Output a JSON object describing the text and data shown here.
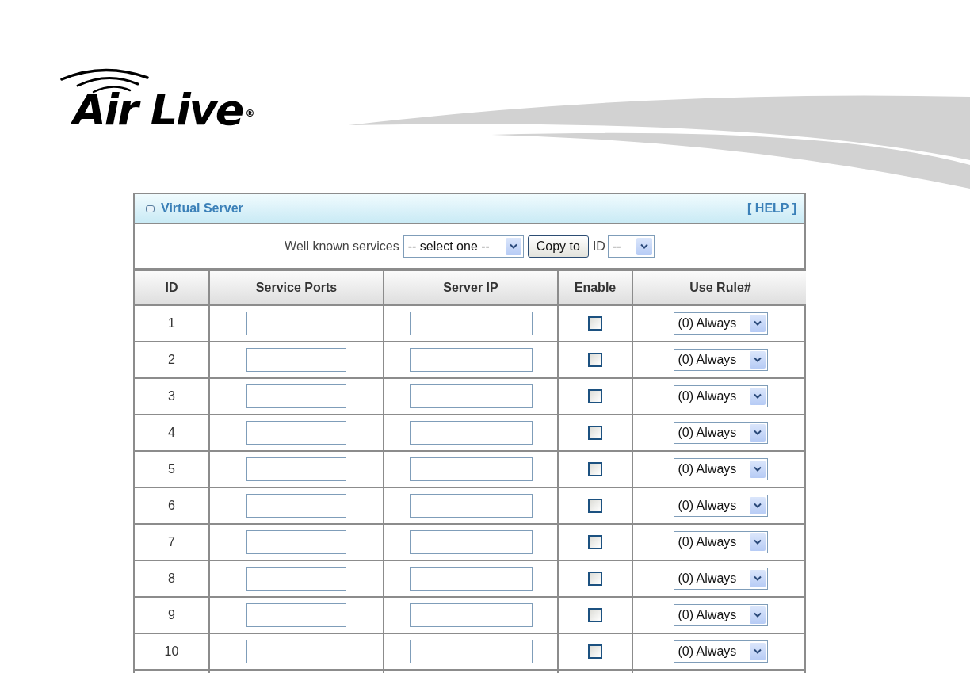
{
  "logo": {
    "text": "Air Live",
    "mark": "®"
  },
  "panel": {
    "title": "Virtual Server",
    "help": "[ HELP ]",
    "services": {
      "label": "Well known services",
      "select": "-- select one --",
      "button": "Copy to",
      "id_label": "ID",
      "id_select": "--"
    },
    "columns": [
      "ID",
      "Service Ports",
      "Server IP",
      "Enable",
      "Use Rule#"
    ],
    "rows": [
      {
        "id": "1",
        "enabled": false,
        "rule": "(0) Always"
      },
      {
        "id": "2",
        "enabled": false,
        "rule": "(0) Always"
      },
      {
        "id": "3",
        "enabled": false,
        "rule": "(0) Always"
      },
      {
        "id": "4",
        "enabled": false,
        "rule": "(0) Always"
      },
      {
        "id": "5",
        "enabled": false,
        "rule": "(0) Always"
      },
      {
        "id": "6",
        "enabled": false,
        "rule": "(0) Always"
      },
      {
        "id": "7",
        "enabled": false,
        "rule": "(0) Always"
      },
      {
        "id": "8",
        "enabled": false,
        "rule": "(0) Always"
      },
      {
        "id": "9",
        "enabled": false,
        "rule": "(0) Always"
      },
      {
        "id": "10",
        "enabled": false,
        "rule": "(0) Always"
      }
    ]
  }
}
